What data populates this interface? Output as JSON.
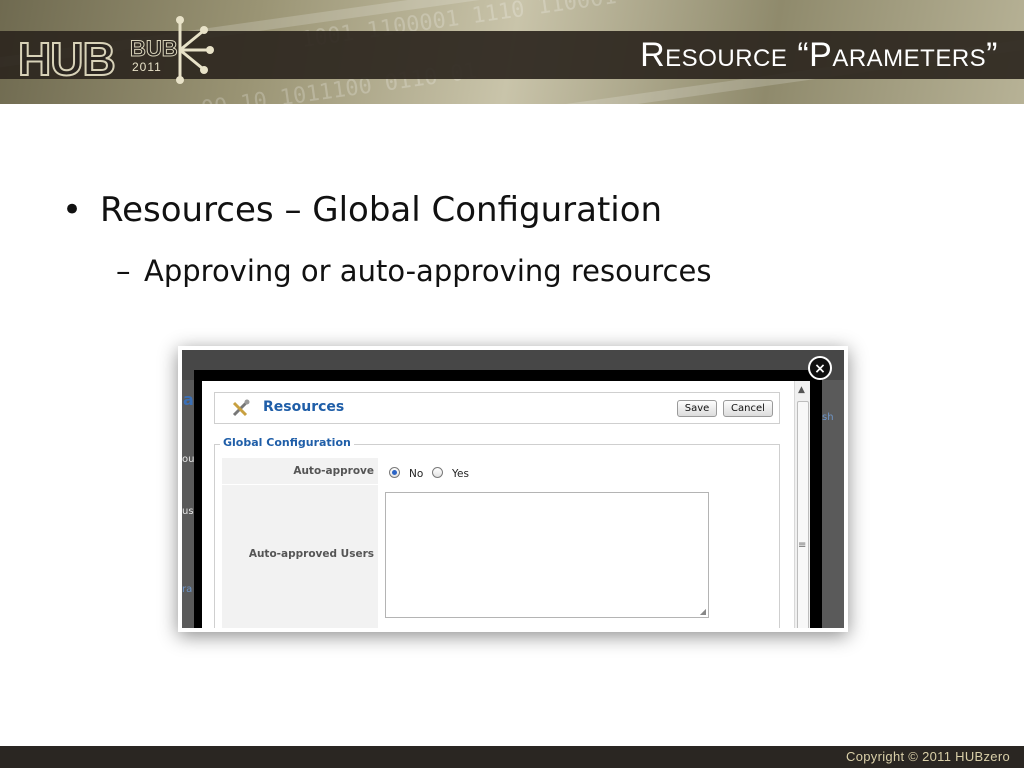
{
  "slide": {
    "title": "Resource “Parameters”",
    "logo": {
      "word": "HUB",
      "sub": "BUB",
      "year": "2011"
    },
    "bullets": [
      "Resources – Global Configuration",
      "Approving or auto-approving resources"
    ],
    "bullet_marker": "•",
    "sub_marker": "–",
    "copyright": "Copyright © 2011 HUBzero"
  },
  "screenshot": {
    "component_title": "Resources",
    "save_label": "Save",
    "cancel_label": "Cancel",
    "close_glyph": "×",
    "section_label": "Global Configuration",
    "fields": {
      "auto_approve_label": "Auto-approve",
      "auto_approve_options": [
        "No",
        "Yes"
      ],
      "auto_approve_selected": "No",
      "auto_approved_users_label": "Auto-approved Users",
      "auto_approved_users_value": ""
    },
    "background_peek": [
      "a",
      "ou",
      "us",
      "ra",
      "sh"
    ]
  },
  "colors": {
    "accent_blue": "#1f5ea8",
    "footer_bg": "#2a2622",
    "title_bar": "#2d261e"
  }
}
